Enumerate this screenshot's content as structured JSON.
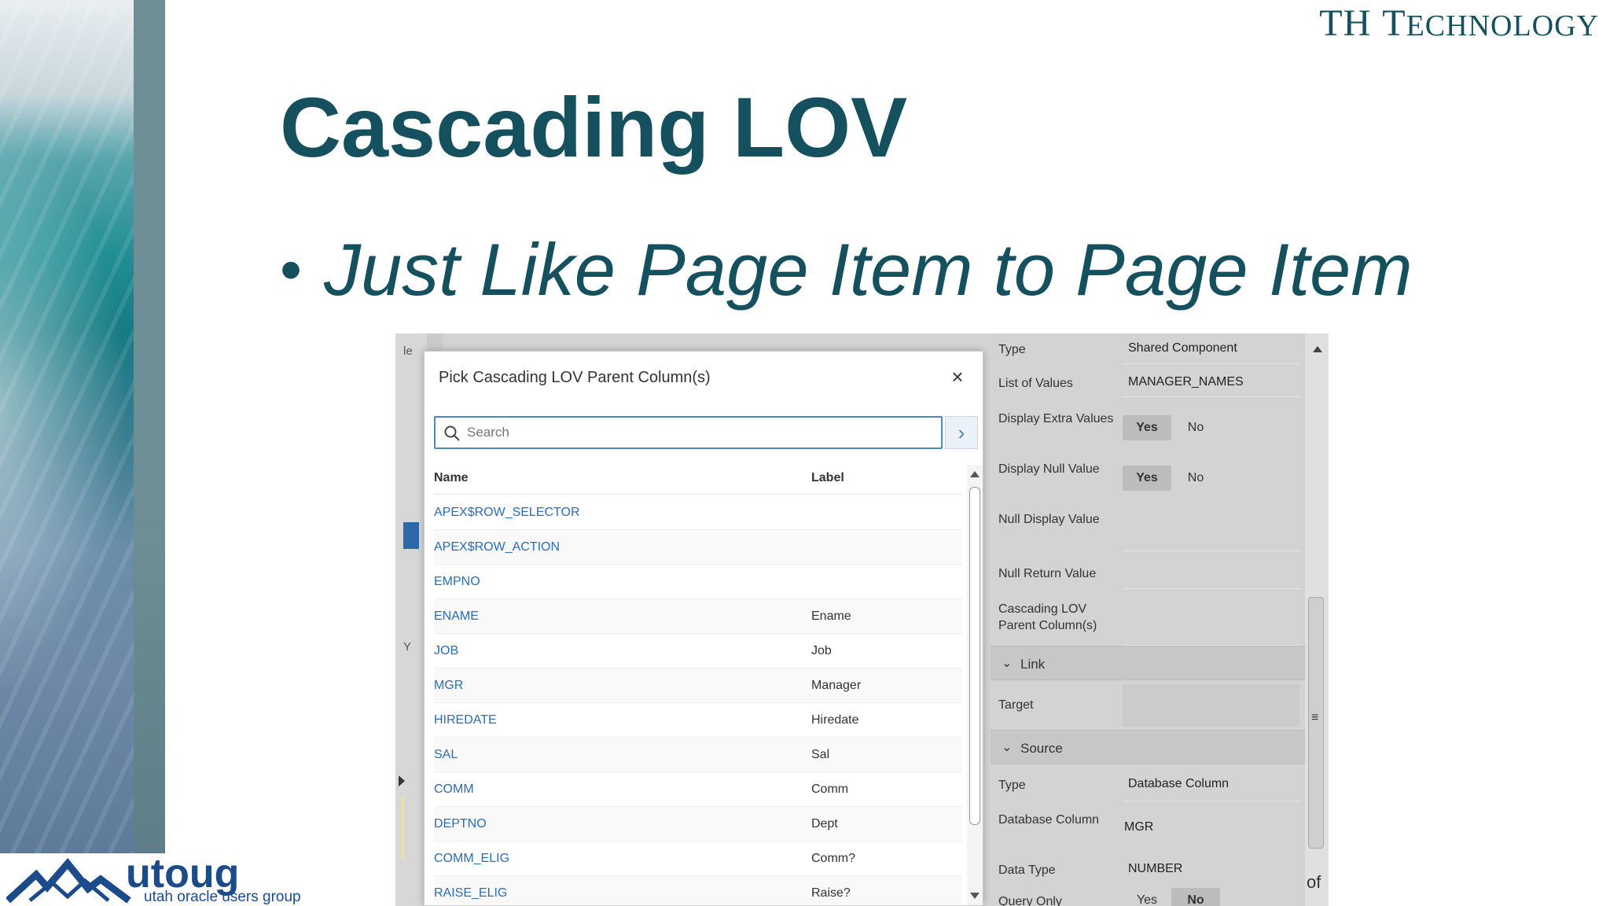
{
  "brand": {
    "initials": "TH",
    "word_first": "T",
    "word_rest": "ECHNOLOGY"
  },
  "slide": {
    "title": "Cascading LOV",
    "bullet": "Just Like Page Item to Page Item"
  },
  "logo": {
    "name": "utoug",
    "tagline": "utah oracle users group"
  },
  "left_edge": {
    "top_text": "le",
    "mid_text": "Y"
  },
  "dialog": {
    "title": "Pick Cascading LOV Parent Column(s)",
    "close_glyph": "×",
    "search": {
      "placeholder": "Search",
      "value": ""
    },
    "go_glyph": "›",
    "columns": {
      "name": "Name",
      "label": "Label"
    },
    "rows": [
      {
        "name": "APEX$ROW_SELECTOR",
        "label": ""
      },
      {
        "name": "APEX$ROW_ACTION",
        "label": ""
      },
      {
        "name": "EMPNO",
        "label": ""
      },
      {
        "name": "ENAME",
        "label": "Ename"
      },
      {
        "name": "JOB",
        "label": "Job"
      },
      {
        "name": "MGR",
        "label": "Manager"
      },
      {
        "name": "HIREDATE",
        "label": "Hiredate"
      },
      {
        "name": "SAL",
        "label": "Sal"
      },
      {
        "name": "COMM",
        "label": "Comm"
      },
      {
        "name": "DEPTNO",
        "label": "Dept"
      },
      {
        "name": "COMM_ELIG",
        "label": "Comm?"
      },
      {
        "name": "RAISE_ELIG",
        "label": "Raise?"
      }
    ]
  },
  "properties": {
    "type": {
      "label": "Type",
      "value": "Shared Component"
    },
    "list_of_values": {
      "label": "List of Values",
      "value": "MANAGER_NAMES"
    },
    "display_extra_values": {
      "label": "Display Extra Values",
      "yes": "Yes",
      "no": "No",
      "selected": "Yes"
    },
    "display_null_value": {
      "label": "Display Null Value",
      "yes": "Yes",
      "no": "No",
      "selected": "Yes"
    },
    "null_display_value": {
      "label": "Null Display Value",
      "value": ""
    },
    "null_return_value": {
      "label": "Null Return Value",
      "value": ""
    },
    "cascading_parent": {
      "label": "Cascading LOV Parent Column(s)",
      "value": ""
    },
    "link_section": {
      "title": "Link"
    },
    "target": {
      "label": "Target",
      "value": ""
    },
    "source_section": {
      "title": "Source"
    },
    "source_type": {
      "label": "Type",
      "value": "Database Column"
    },
    "database_column": {
      "label": "Database Column",
      "value": "MGR"
    },
    "data_type": {
      "label": "Data Type",
      "value": "NUMBER"
    },
    "query_only": {
      "label": "Query Only",
      "yes": "Yes",
      "no": "No",
      "selected": "No"
    }
  },
  "panel_fragment": "of"
}
